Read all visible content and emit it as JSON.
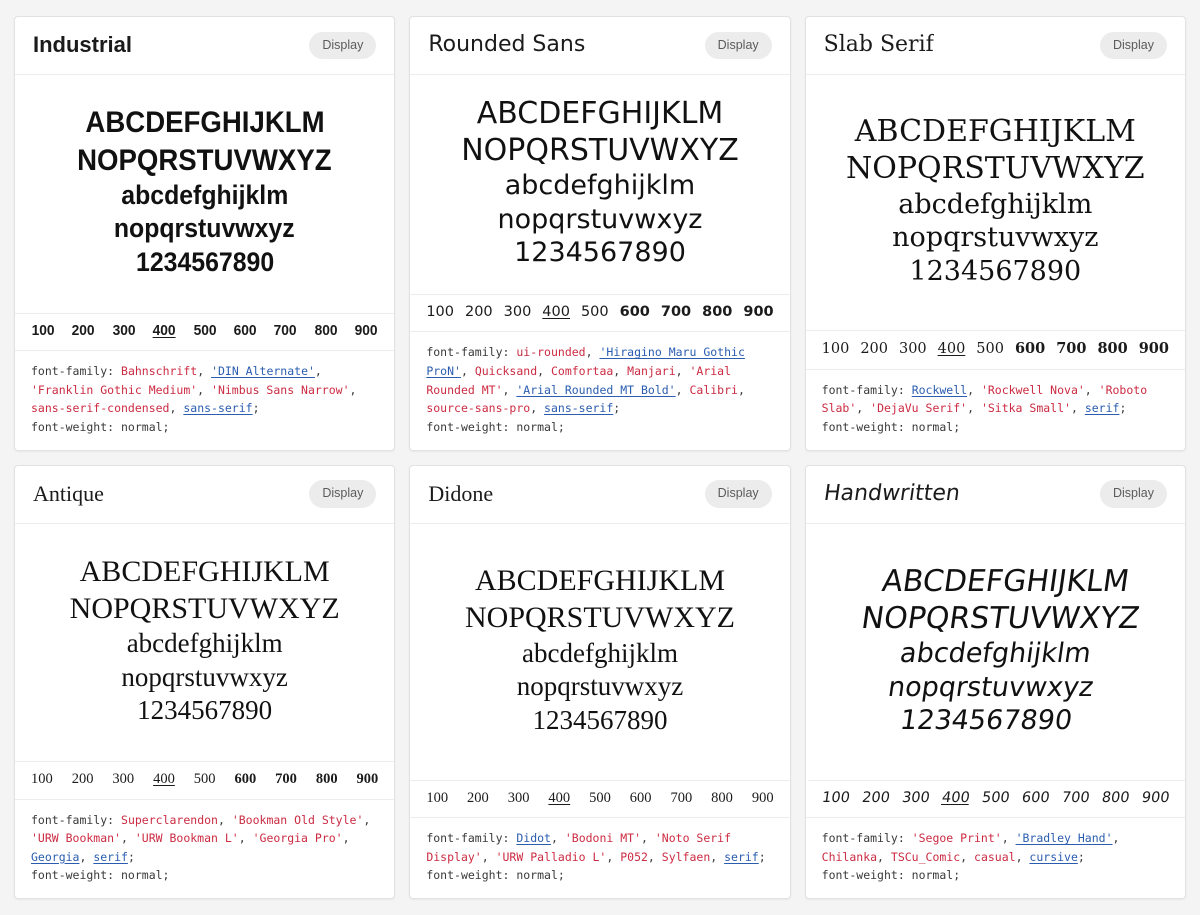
{
  "page": {
    "background": "#f4f4f4",
    "card_background": "#ffffff",
    "colors": {
      "font_missing": "#cc2b42",
      "font_present": "#2a5db0",
      "code_text": "#3a3a3a",
      "badge_bg": "#ececec",
      "badge_text": "#5b5b5b"
    }
  },
  "weights": {
    "scale": [
      "100",
      "200",
      "300",
      "400",
      "500",
      "600",
      "700",
      "800",
      "900"
    ],
    "current": "400"
  },
  "specimen": {
    "upper_1": "ABCDEFGHIJKLM",
    "upper_2": "NOPQRSTUVWXYZ",
    "lower_1": "abcdefghijklm",
    "lower_2": "nopqrstuvwxyz",
    "digits": "1234567890"
  },
  "code_labels": {
    "font_family": "font-family:",
    "font_weight": "font-weight: normal;"
  },
  "cards": [
    {
      "title": "Industrial",
      "badge": "Display",
      "css_font_stack": "Bahnschrift, 'DIN Alternate', 'Franklin Gothic Medium', 'Nimbus Sans Narrow', sans-serif-condensed, sans-serif;",
      "font_weight_declaration": "font-weight: normal;",
      "stack": [
        {
          "name": "Bahnschrift",
          "available": false
        },
        {
          "name": "'DIN Alternate'",
          "available": true
        },
        {
          "name": "'Franklin Gothic Medium'",
          "available": false
        },
        {
          "name": "'Nimbus Sans Narrow'",
          "available": false
        },
        {
          "name": "sans-serif-condensed",
          "available": false
        },
        {
          "name": "sans-serif",
          "available": true
        }
      ],
      "bold_weights": [
        "100",
        "200",
        "300",
        "400",
        "500",
        "600",
        "700",
        "800",
        "900"
      ]
    },
    {
      "title": "Rounded Sans",
      "badge": "Display",
      "css_font_stack": "ui-rounded, 'Hiragino Maru Gothic ProN', Quicksand, Comfortaa, Manjari, 'Arial Rounded MT', 'Arial Rounded MT Bold', Calibri, source-sans-pro, sans-serif;",
      "font_weight_declaration": "font-weight: normal;",
      "stack": [
        {
          "name": "ui-rounded",
          "available": false
        },
        {
          "name": "'Hiragino Maru Gothic ProN'",
          "available": true
        },
        {
          "name": "Quicksand",
          "available": false
        },
        {
          "name": "Comfortaa",
          "available": false
        },
        {
          "name": "Manjari",
          "available": false
        },
        {
          "name": "'Arial Rounded MT'",
          "available": false
        },
        {
          "name": "'Arial Rounded MT Bold'",
          "available": true
        },
        {
          "name": "Calibri",
          "available": false
        },
        {
          "name": "source-sans-pro",
          "available": false
        },
        {
          "name": "sans-serif",
          "available": true
        }
      ],
      "bold_weights": [
        "600",
        "700",
        "800",
        "900"
      ]
    },
    {
      "title": "Slab Serif",
      "badge": "Display",
      "css_font_stack": "Rockwell, 'Rockwell Nova', 'Roboto Slab', 'DejaVu Serif', 'Sitka Small', serif;",
      "font_weight_declaration": "font-weight: normal;",
      "stack": [
        {
          "name": "Rockwell",
          "available": true
        },
        {
          "name": "'Rockwell Nova'",
          "available": false
        },
        {
          "name": "'Roboto Slab'",
          "available": false
        },
        {
          "name": "'DejaVu Serif'",
          "available": false
        },
        {
          "name": "'Sitka Small'",
          "available": false
        },
        {
          "name": "serif",
          "available": true
        }
      ],
      "bold_weights": [
        "600",
        "700",
        "800",
        "900"
      ]
    },
    {
      "title": "Antique",
      "badge": "Display",
      "css_font_stack": "Superclarendon, 'Bookman Old Style', 'URW Bookman', 'URW Bookman L', 'Georgia Pro', Georgia, serif;",
      "font_weight_declaration": "font-weight: normal;",
      "stack": [
        {
          "name": "Superclarendon",
          "available": false
        },
        {
          "name": "'Bookman Old Style'",
          "available": false
        },
        {
          "name": "'URW Bookman'",
          "available": false
        },
        {
          "name": "'URW Bookman L'",
          "available": false
        },
        {
          "name": "'Georgia Pro'",
          "available": false
        },
        {
          "name": "Georgia",
          "available": true
        },
        {
          "name": "serif",
          "available": true
        }
      ],
      "bold_weights": [
        "600",
        "700",
        "800",
        "900"
      ]
    },
    {
      "title": "Didone",
      "badge": "Display",
      "css_font_stack": "Didot, 'Bodoni MT', 'Noto Serif Display', 'URW Palladio L', P052, Sylfaen, serif;",
      "font_weight_declaration": "font-weight: normal;",
      "stack": [
        {
          "name": "Didot",
          "available": true
        },
        {
          "name": "'Bodoni MT'",
          "available": false
        },
        {
          "name": "'Noto Serif Display'",
          "available": false
        },
        {
          "name": "'URW Palladio L'",
          "available": false
        },
        {
          "name": "P052",
          "available": false
        },
        {
          "name": "Sylfaen",
          "available": false
        },
        {
          "name": "serif",
          "available": true
        }
      ],
      "bold_weights": []
    },
    {
      "title": "Handwritten",
      "badge": "Display",
      "css_font_stack": "'Segoe Print', 'Bradley Hand', Chilanka, TSCu_Comic, casual, cursive;",
      "font_weight_declaration": "font-weight: normal;",
      "stack": [
        {
          "name": "'Segoe Print'",
          "available": false
        },
        {
          "name": "'Bradley Hand'",
          "available": true
        },
        {
          "name": "Chilanka",
          "available": false
        },
        {
          "name": "TSCu_Comic",
          "available": false
        },
        {
          "name": "casual",
          "available": false
        },
        {
          "name": "cursive",
          "available": true
        }
      ],
      "bold_weights": []
    }
  ]
}
